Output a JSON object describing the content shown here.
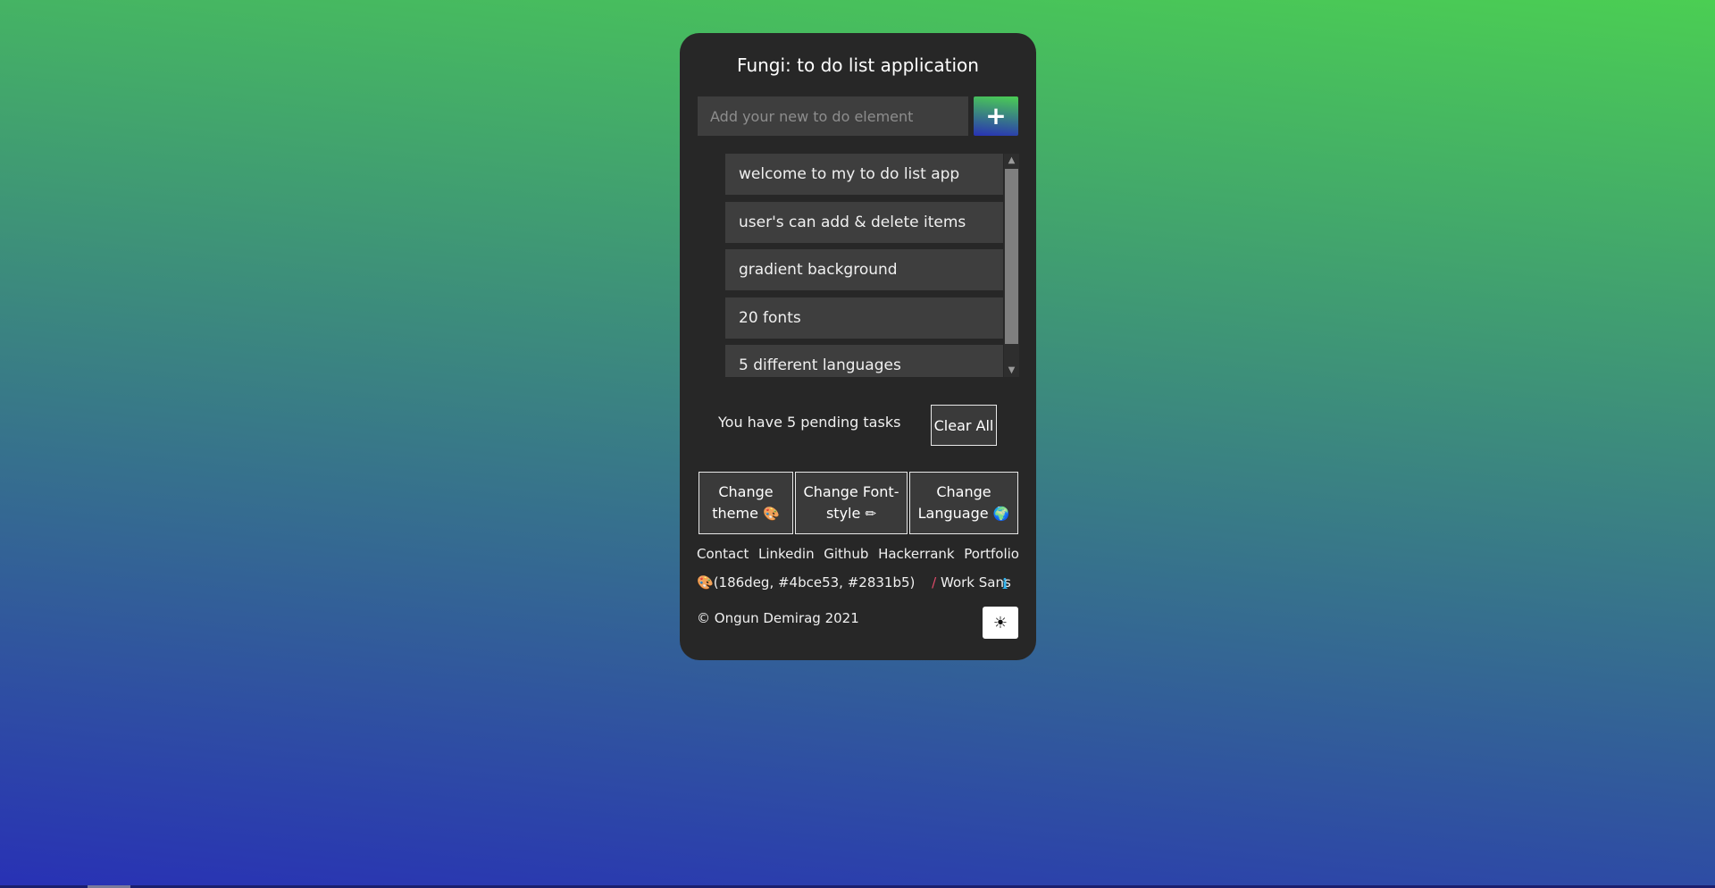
{
  "app": {
    "title": "Fungi: to do list application"
  },
  "new_todo": {
    "placeholder": "Add your new to do element",
    "value": "",
    "add_icon": "plus-icon",
    "add_symbol": "+"
  },
  "todos": [
    {
      "text": "welcome to my to do list app"
    },
    {
      "text": "user's can add & delete items"
    },
    {
      "text": "gradient background"
    },
    {
      "text": "20 fonts"
    },
    {
      "text": "5 different languages"
    }
  ],
  "scrollbar": {
    "up_symbol": "▲",
    "down_symbol": "▼"
  },
  "summary": {
    "pending_text": "You have 5 pending tasks",
    "clear_label": "Clear All"
  },
  "options": {
    "theme_label": "Change theme",
    "theme_icon": "🎨",
    "font_label": "Change Font-style",
    "font_icon": "✏",
    "language_label": "Change Language",
    "language_icon": "🌍"
  },
  "links": [
    "Contact",
    "Linkedin",
    "Github",
    "Hackerrank",
    "Portfolio"
  ],
  "status": {
    "palette_icon": "🎨",
    "gradient_text": "(186deg, #4bce53, #2831b5)",
    "pen_icon": "/",
    "font_text": "Work Sans",
    "info_symbol": "ℹ"
  },
  "footer": {
    "copyright": "© Ongun Demirag 2021",
    "mode_icon": "☀"
  },
  "colors": {
    "gradient_start": "#4bce53",
    "gradient_end": "#2831b5",
    "card_bg": "#272727",
    "item_bg": "#3e3e3e",
    "info": "#33b5f0"
  }
}
